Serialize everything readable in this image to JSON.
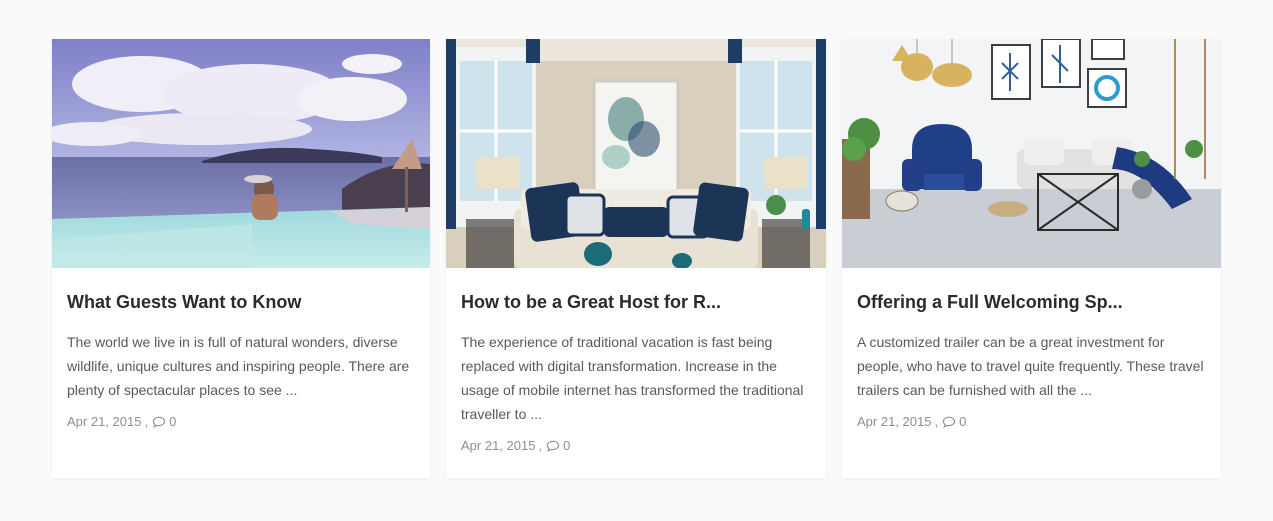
{
  "posts": [
    {
      "title": "What Guests Want to Know",
      "excerpt": "The world we live in is full of natural wonders, diverse wildlife, unique cultures and inspiring people. There are plenty of spectacular places to see ...",
      "date": "Apr 21, 2015",
      "separator": ",",
      "comments": "0",
      "image": "infinity-pool-sea-view"
    },
    {
      "title": "How to be a Great Host for R...",
      "excerpt": "The experience of traditional vacation is fast being replaced with digital transformation. Increase in the usage of mobile internet has transformed the traditional traveller to ...",
      "date": "Apr 21, 2015",
      "separator": ",",
      "comments": "0",
      "image": "living-room-sofa"
    },
    {
      "title": "Offering a Full Welcoming Sp...",
      "excerpt": "A customized trailer can be a great investment for people, who have to travel quite frequently. These travel trailers can be furnished with all the ...",
      "date": "Apr 21, 2015",
      "separator": ",",
      "comments": "0",
      "image": "bright-lounge-armchair"
    }
  ],
  "icons": {
    "comment": "comment-icon"
  },
  "colors": {
    "background": "#fafafa",
    "card": "#ffffff",
    "title": "#2b2b2b",
    "text": "#555a60",
    "meta": "#8b8f96"
  }
}
